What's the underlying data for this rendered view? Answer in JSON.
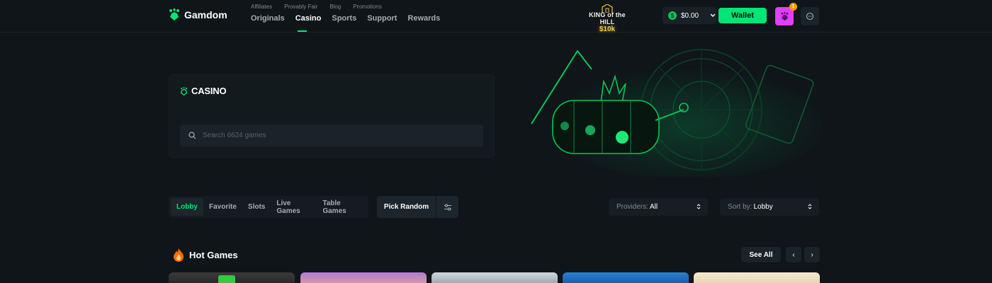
{
  "brand": {
    "name": "Gamdom"
  },
  "header": {
    "subnav": [
      "Affiliates",
      "Provably Fair",
      "Blog",
      "Promotions"
    ],
    "mainnav": [
      "Originals",
      "Casino",
      "Sports",
      "Support",
      "Rewards"
    ],
    "active_nav": "Casino",
    "promo": {
      "title": "KING of the HILL",
      "prize": "$10k"
    },
    "balance": "$0.00",
    "wallet_label": "Wallet",
    "notification_count": "1"
  },
  "hero": {
    "title": "CASINO",
    "search_placeholder": "Search 6624 games"
  },
  "filters": {
    "tabs": [
      "Lobby",
      "Favorite",
      "Slots",
      "Live Games",
      "Table Games"
    ],
    "active_tab": "Lobby",
    "pick_random_label": "Pick Random",
    "providers": {
      "label": "Providers:",
      "value": "All"
    },
    "sort": {
      "label": "Sort by:",
      "value": "Lobby"
    }
  },
  "hot_games": {
    "title": "Hot Games",
    "see_all_label": "See All",
    "prev_label": "‹",
    "next_label": "›"
  },
  "colors": {
    "accent": "#00e676",
    "background": "#0f1519",
    "avatar": "#e040fb",
    "badge": "#ff9800"
  }
}
